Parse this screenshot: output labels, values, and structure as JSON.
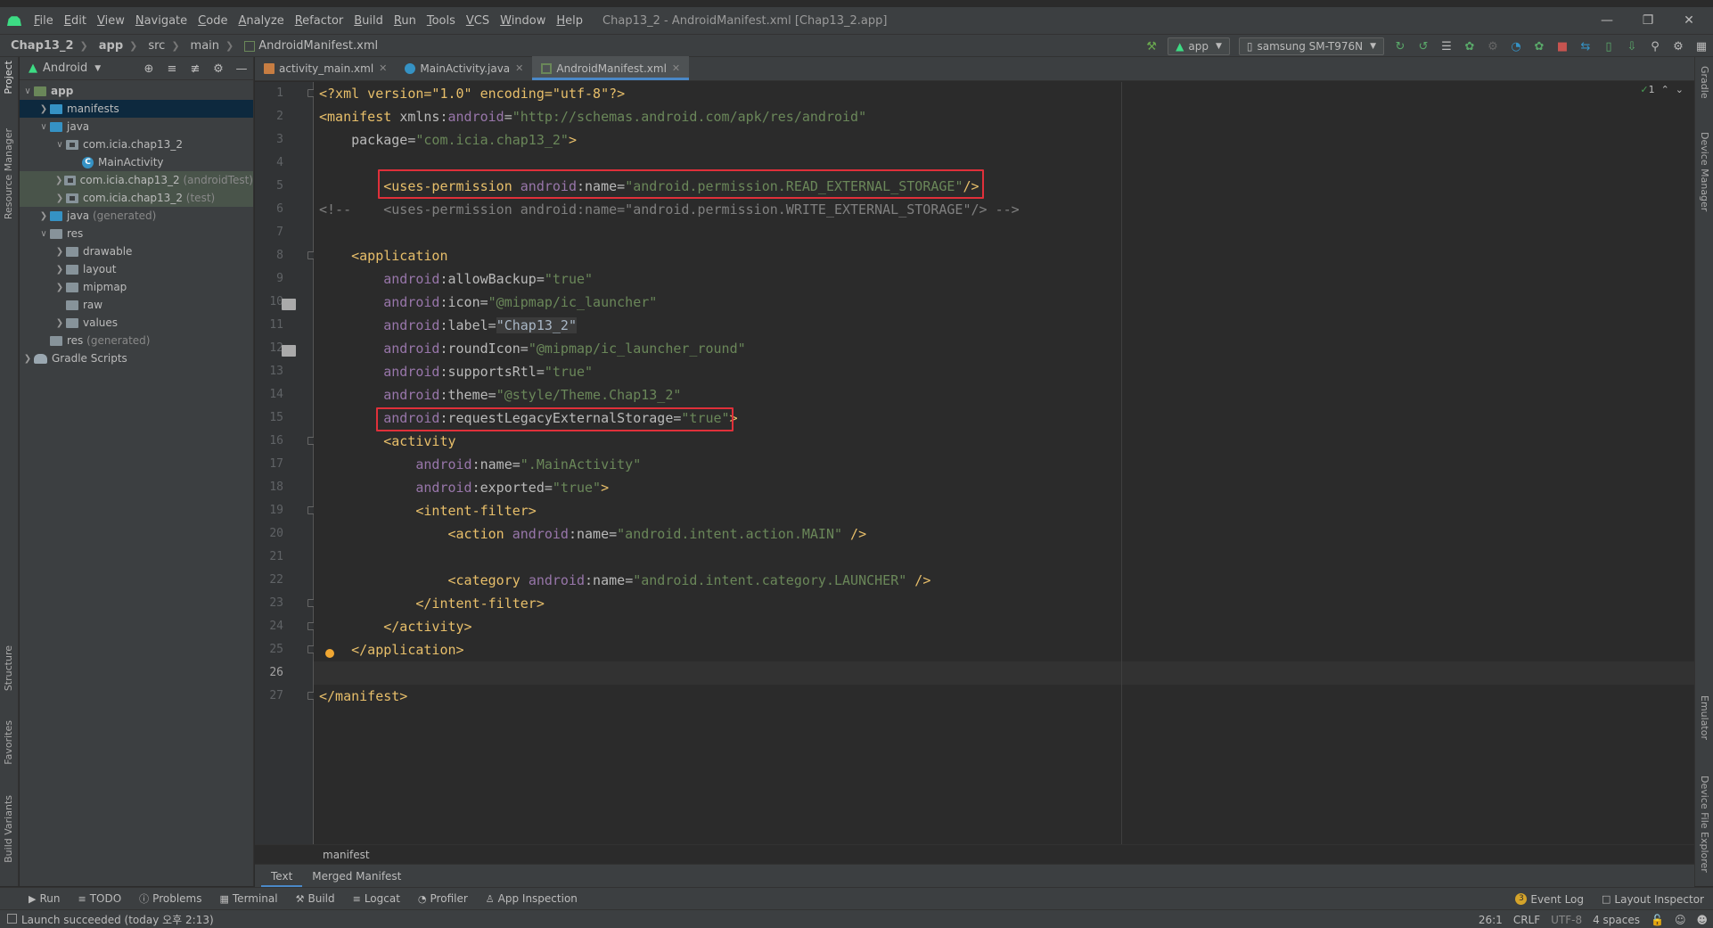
{
  "menubar": {
    "items": [
      "File",
      "Edit",
      "View",
      "Navigate",
      "Code",
      "Analyze",
      "Refactor",
      "Build",
      "Run",
      "Tools",
      "VCS",
      "Window",
      "Help"
    ],
    "window_title": "Chap13_2 - AndroidManifest.xml [Chap13_2.app]"
  },
  "navbar": {
    "crumbs": [
      "Chap13_2",
      "app",
      "src",
      "main",
      "AndroidManifest.xml"
    ],
    "run_config": "app",
    "device": "samsung SM-T976N"
  },
  "project": {
    "view_label": "Android",
    "tree": [
      {
        "label": "app",
        "extra": ""
      },
      {
        "label": "manifests",
        "extra": ""
      },
      {
        "label": "java",
        "extra": ""
      },
      {
        "label": "com.icia.chap13_2",
        "extra": ""
      },
      {
        "label": "MainActivity",
        "extra": ""
      },
      {
        "label": "com.icia.chap13_2",
        "extra": "(androidTest)"
      },
      {
        "label": "com.icia.chap13_2",
        "extra": "(test)"
      },
      {
        "label": "java",
        "extra": "(generated)"
      },
      {
        "label": "res",
        "extra": ""
      },
      {
        "label": "drawable",
        "extra": ""
      },
      {
        "label": "layout",
        "extra": ""
      },
      {
        "label": "mipmap",
        "extra": ""
      },
      {
        "label": "raw",
        "extra": ""
      },
      {
        "label": "values",
        "extra": ""
      },
      {
        "label": "res",
        "extra": "(generated)"
      },
      {
        "label": "Gradle Scripts",
        "extra": ""
      }
    ]
  },
  "left_stripe": [
    "Project",
    "Resource Manager",
    "Structure",
    "Favorites",
    "Build Variants"
  ],
  "right_stripe": [
    "Gradle",
    "Device Manager",
    "Emulator",
    "Device File Explorer"
  ],
  "tabs": [
    "activity_main.xml",
    "MainActivity.java",
    "AndroidManifest.xml"
  ],
  "editor": {
    "inspection_count": "1",
    "line_numbers": [
      "1",
      "2",
      "3",
      "4",
      "5",
      "6",
      "7",
      "8",
      "9",
      "10",
      "11",
      "12",
      "13",
      "14",
      "15",
      "16",
      "17",
      "18",
      "19",
      "20",
      "21",
      "22",
      "23",
      "24",
      "25",
      "26",
      "27"
    ],
    "code": {
      "l1a": "<?xml version=\"1.0\" encoding=\"utf-8\"?>",
      "l2_tag": "<manifest ",
      "l2_attr": "xmlns:",
      "l2_ns": "android",
      "l2_eq": "=",
      "l2_val": "\"http://schemas.android.com/apk/res/android\"",
      "l3_attr": "package",
      "l3_eq": "=",
      "l3_val": "\"com.icia.chap13_2\"",
      "l3_end": ">",
      "l5_tag": "<uses-permission ",
      "l5_ns": "android",
      "l5_attr": ":name",
      "l5_eq": "=",
      "l5_val": "\"android.permission.READ_EXTERNAL_STORAGE\"",
      "l5_end": "/>",
      "l6": "<!--    <uses-permission android:name=\"android.permission.WRITE_EXTERNAL_STORAGE\"/> -->",
      "l8": "<application",
      "l9_ns": "android",
      "l9_attr": ":allowBackup",
      "l9_eq": "=",
      "l9_val": "\"true\"",
      "l10_ns": "android",
      "l10_attr": ":icon",
      "l10_eq": "=",
      "l10_val": "\"@mipmap/ic_launcher\"",
      "l11_ns": "android",
      "l11_attr": ":label",
      "l11_eq": "=",
      "l11_val": "\"Chap13_2\"",
      "l12_ns": "android",
      "l12_attr": ":roundIcon",
      "l12_eq": "=",
      "l12_val": "\"@mipmap/ic_launcher_round\"",
      "l13_ns": "android",
      "l13_attr": ":supportsRtl",
      "l13_eq": "=",
      "l13_val": "\"true\"",
      "l14_ns": "android",
      "l14_attr": ":theme",
      "l14_eq": "=",
      "l14_val": "\"@style/Theme.Chap13_2\"",
      "l15_ns": "android",
      "l15_attr": ":requestLegacyExternalStorage",
      "l15_eq": "=",
      "l15_val": "\"true\"",
      "l15_end": ">",
      "l16": "<activity",
      "l17_ns": "android",
      "l17_attr": ":name",
      "l17_eq": "=",
      "l17_val": "\".MainActivity\"",
      "l18_ns": "android",
      "l18_attr": ":exported",
      "l18_eq": "=",
      "l18_val": "\"true\"",
      "l18_end": ">",
      "l19": "<intent-filter>",
      "l20_tag": "<action ",
      "l20_ns": "android",
      "l20_attr": ":name",
      "l20_eq": "=",
      "l20_val": "\"android.intent.action.MAIN\"",
      "l20_end": " />",
      "l22_tag": "<category ",
      "l22_ns": "android",
      "l22_attr": ":name",
      "l22_eq": "=",
      "l22_val": "\"android.intent.category.LAUNCHER\"",
      "l22_end": " />",
      "l23": "</intent-filter>",
      "l24": "</activity>",
      "l25": "</application>",
      "l27": "</manifest>"
    }
  },
  "breadcrumb": "manifest",
  "manifest_tabs": [
    "Text",
    "Merged Manifest"
  ],
  "toolwindows": [
    "Run",
    "TODO",
    "Problems",
    "Terminal",
    "Build",
    "Logcat",
    "Profiler",
    "App Inspection"
  ],
  "toolwindows_right": {
    "event_log": "Event Log",
    "event_count": "3",
    "layout_inspector": "Layout Inspector"
  },
  "status": {
    "message": "Launch succeeded (today 오후 2:13)",
    "position": "26:1",
    "line_sep": "CRLF",
    "encoding": "UTF-8",
    "indent": "4 spaces"
  },
  "colors": {
    "accent": "#4a88c7",
    "highlight_box": "#e0303a",
    "tag": "#e8bf6a",
    "string": "#6a8759",
    "namespace": "#9876aa"
  }
}
